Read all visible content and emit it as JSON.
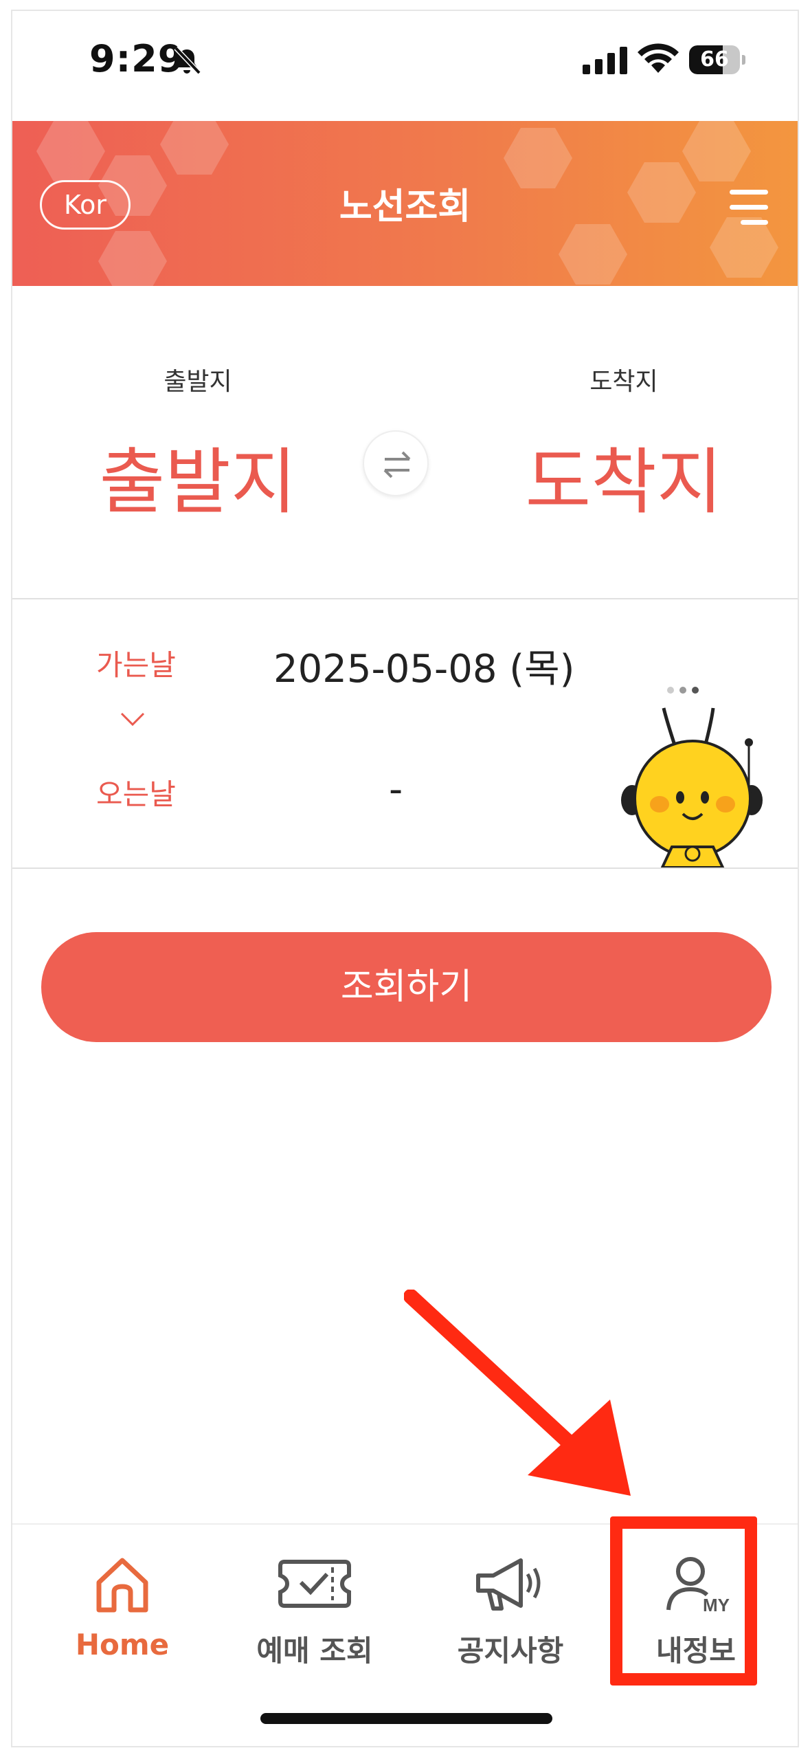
{
  "status_bar": {
    "time": "9:29",
    "battery_level": "66"
  },
  "header": {
    "language_button": "Kor",
    "title": "노선조회",
    "menu_icon": "hamburger-icon"
  },
  "route": {
    "departure_label": "출발지",
    "departure_value": "출발지",
    "arrival_label": "도착지",
    "arrival_value": "도착지",
    "swap_icon": "swap-arrows-icon"
  },
  "dates": {
    "departure_label": "가는날",
    "departure_value": "2025-05-08 (목)",
    "return_label": "오는날",
    "return_value": "-"
  },
  "search_button": "조회하기",
  "bottom_nav": [
    {
      "label": "Home",
      "icon": "home-icon",
      "active": true
    },
    {
      "label": "예매 조회",
      "icon": "ticket-check-icon",
      "active": false
    },
    {
      "label": "공지사항",
      "icon": "megaphone-icon",
      "active": false
    },
    {
      "label": "내정보",
      "icon": "my-profile-icon",
      "active": false
    }
  ],
  "colors": {
    "accent": "#ef5f52",
    "header_start": "#ee5f55",
    "header_end": "#f3963f",
    "nav_active": "#e86a3e",
    "annotation": "#ff2a12"
  }
}
